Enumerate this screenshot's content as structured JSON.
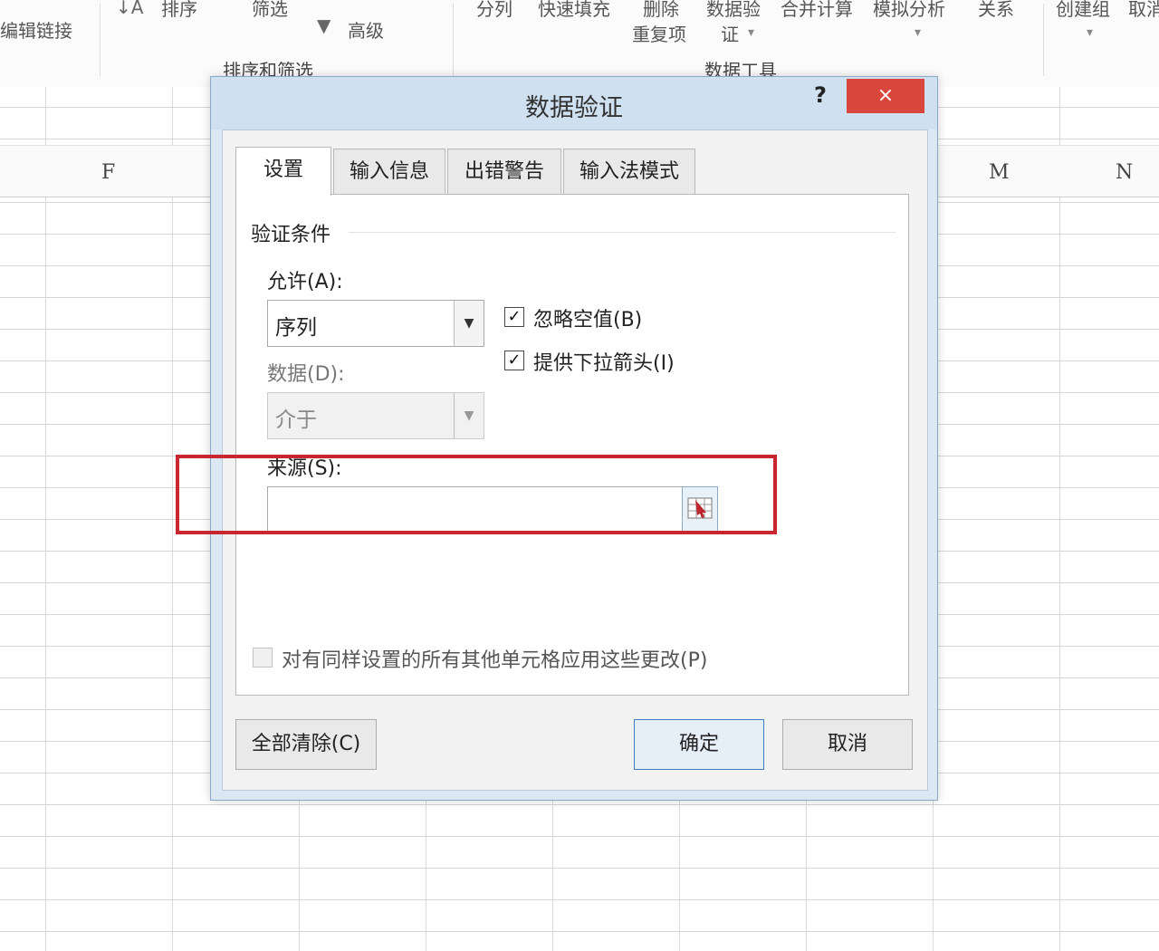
{
  "ribbon": {
    "edit_links": "编辑链接",
    "sort": "排序",
    "filter": "筛选",
    "advanced": "高级",
    "sort_filter_group": "排序和筛选",
    "text_to_columns": "分列",
    "flash_fill": "快速填充",
    "remove_dup_line1": "删除",
    "remove_dup_line2": "重复项",
    "data_validation_line1": "数据验",
    "data_validation_line2": "证",
    "consolidate": "合并计算",
    "what_if": "模拟分析",
    "relationships": "关系",
    "data_tools_group": "数据工具",
    "group": "创建组",
    "ungroup": "取消"
  },
  "columns": [
    "F",
    "M",
    "N"
  ],
  "dialog": {
    "title": "数据验证",
    "help": "?",
    "close": "×",
    "tabs": [
      {
        "label": "设置",
        "active": true
      },
      {
        "label": "输入信息",
        "active": false
      },
      {
        "label": "出错警告",
        "active": false
      },
      {
        "label": "输入法模式",
        "active": false
      }
    ],
    "section_label": "验证条件",
    "allow_label": "允许(A):",
    "allow_value": "序列",
    "ignore_blank_label": "忽略空值(B)",
    "ignore_blank_checked": true,
    "dropdown_label": "提供下拉箭头(I)",
    "dropdown_checked": true,
    "data_label": "数据(D):",
    "data_value": "介于",
    "source_label": "来源(S):",
    "source_value": "",
    "apply_all_label": "对有同样设置的所有其他单元格应用这些更改(P)",
    "apply_all_checked": false,
    "clear_all_button": "全部清除(C)",
    "ok_button": "确定",
    "cancel_button": "取消"
  },
  "colors": {
    "highlight": "#c8272f",
    "close_button": "#d9473c",
    "titlebar": "#cfe0f1"
  }
}
